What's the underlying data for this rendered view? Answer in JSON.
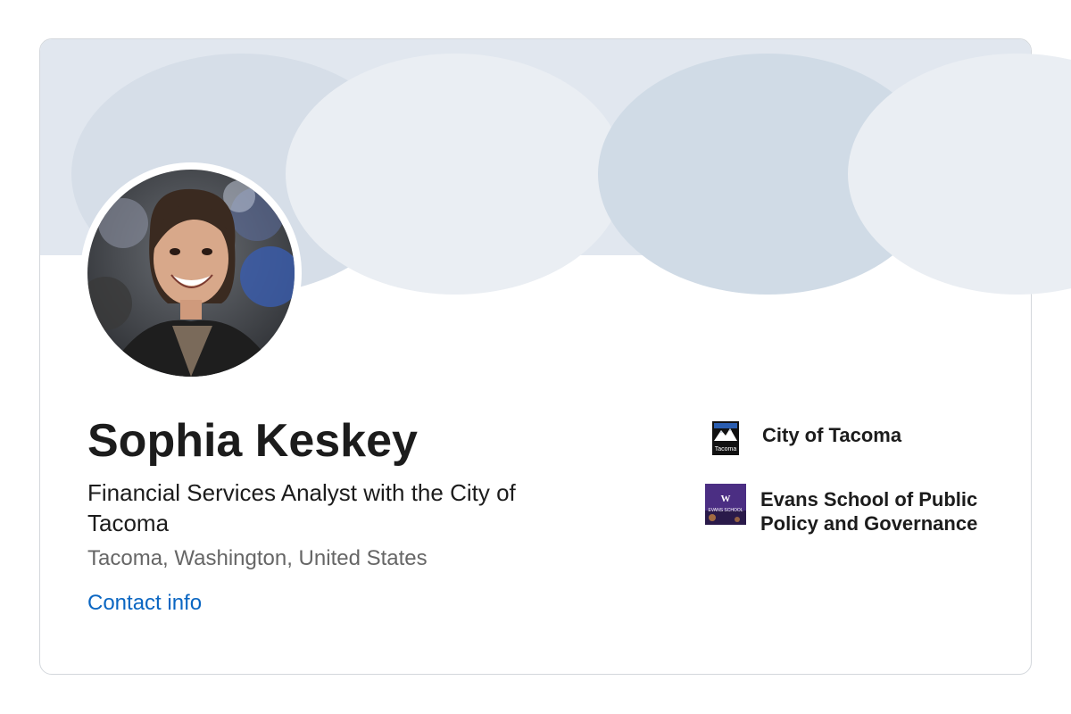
{
  "profile": {
    "name": "Sophia Keskey",
    "headline": "Financial Services Analyst with the City of Tacoma",
    "location": "Tacoma, Washington, United States",
    "contact_label": "Contact info"
  },
  "organizations": [
    {
      "name": "City of Tacoma",
      "logo_text": "Tacoma",
      "logo": "city-of-tacoma-logo"
    },
    {
      "name": "Evans School of Public Policy and Governance",
      "logo_text_top": "W",
      "logo_text_bottom": "EVANS SCHOOL",
      "logo": "evans-school-logo"
    }
  ],
  "colors": {
    "banner": "#e1e7ef",
    "link": "#0a66c2",
    "text": "#1c1c1c",
    "muted": "#666666",
    "evans_purple": "#4b2e83"
  }
}
